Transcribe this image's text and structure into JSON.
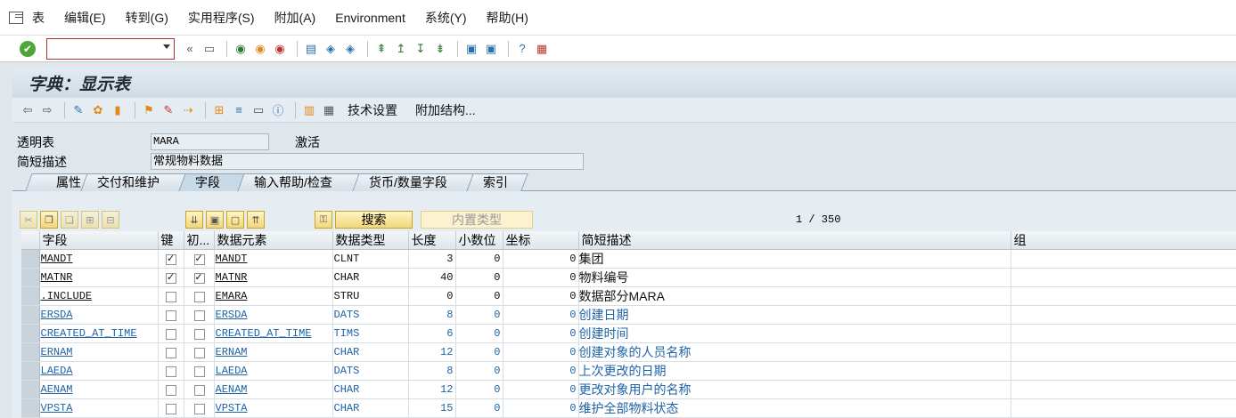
{
  "menu": {
    "items": [
      {
        "label": "表"
      },
      {
        "label": "编辑(E)"
      },
      {
        "label": "转到(G)"
      },
      {
        "label": "实用程序(S)"
      },
      {
        "label": "附加(A)"
      },
      {
        "label": "Environment"
      },
      {
        "label": "系统(Y)"
      },
      {
        "label": "帮助(H)"
      }
    ]
  },
  "toolbar": {
    "command_field_value": "",
    "back_glyph": "«"
  },
  "title": "字典：显示表",
  "app_toolbar": {
    "tech_settings": "技术设置",
    "append_structure": "附加结构..."
  },
  "header": {
    "table_label": "透明表",
    "table_value": "MARA",
    "status": "激活",
    "desc_label": "简短描述",
    "desc_value": "常规物料数据"
  },
  "tabs": [
    {
      "label": "属性"
    },
    {
      "label": "交付和维护"
    },
    {
      "label": "字段",
      "active": true
    },
    {
      "label": "输入帮助/检查"
    },
    {
      "label": "货币/数量字段"
    },
    {
      "label": "索引"
    }
  ],
  "grid_toolbar": {
    "search_label": "搜索",
    "builtin_label": "内置类型",
    "page_info": "1 / 350"
  },
  "columns": [
    "字段",
    "键",
    "初...",
    "数据元素",
    "数据类型",
    "长度",
    "小数位",
    "坐标",
    "简短描述",
    "组"
  ],
  "rows": [
    {
      "field": "MANDT",
      "key": true,
      "init": true,
      "element": "MANDT",
      "type": "CLNT",
      "length": "3",
      "decimals": "0",
      "coord": "0",
      "desc": "集团",
      "group": "",
      "color": "dark"
    },
    {
      "field": "MATNR",
      "key": true,
      "init": true,
      "element": "MATNR",
      "type": "CHAR",
      "length": "40",
      "decimals": "0",
      "coord": "0",
      "desc": "物料编号",
      "group": "",
      "color": "dark"
    },
    {
      "field": ".INCLUDE",
      "key": false,
      "init": false,
      "element": "EMARA",
      "type": "STRU",
      "length": "0",
      "decimals": "0",
      "coord": "0",
      "desc": "数据部分MARA",
      "group": "",
      "color": "dark"
    },
    {
      "field": "ERSDA",
      "key": false,
      "init": false,
      "element": "ERSDA",
      "type": "DATS",
      "length": "8",
      "decimals": "0",
      "coord": "0",
      "desc": "创建日期",
      "group": "",
      "color": "blue"
    },
    {
      "field": "CREATED_AT_TIME",
      "key": false,
      "init": false,
      "element": "CREATED_AT_TIME",
      "type": "TIMS",
      "length": "6",
      "decimals": "0",
      "coord": "0",
      "desc": "创建时间",
      "group": "",
      "color": "blue"
    },
    {
      "field": "ERNAM",
      "key": false,
      "init": false,
      "element": "ERNAM",
      "type": "CHAR",
      "length": "12",
      "decimals": "0",
      "coord": "0",
      "desc": "创建对象的人员名称",
      "group": "",
      "color": "blue"
    },
    {
      "field": "LAEDA",
      "key": false,
      "init": false,
      "element": "LAEDA",
      "type": "DATS",
      "length": "8",
      "decimals": "0",
      "coord": "0",
      "desc": "上次更改的日期",
      "group": "",
      "color": "blue"
    },
    {
      "field": "AENAM",
      "key": false,
      "init": false,
      "element": "AENAM",
      "type": "CHAR",
      "length": "12",
      "decimals": "0",
      "coord": "0",
      "desc": "更改对象用户的名称",
      "group": "",
      "color": "blue"
    },
    {
      "field": "VPSTA",
      "key": false,
      "init": false,
      "element": "VPSTA",
      "type": "CHAR",
      "length": "15",
      "decimals": "0",
      "coord": "0",
      "desc": "维护全部物料状态",
      "group": "",
      "color": "blue"
    }
  ]
}
